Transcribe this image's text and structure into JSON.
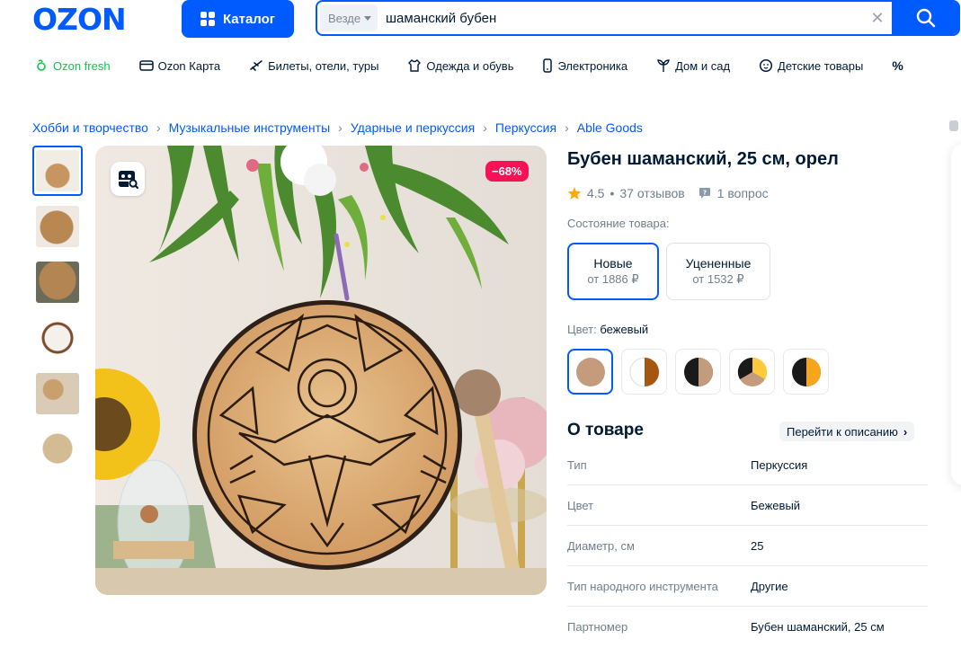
{
  "header": {
    "logo_text": "OZON",
    "catalog_label": "Каталог",
    "search": {
      "scope": "Везде",
      "value": "шаманский бубен"
    }
  },
  "nav": [
    {
      "label": "Ozon fresh",
      "icon": "fresh-icon"
    },
    {
      "label": "Ozon Карта",
      "icon": "card-icon"
    },
    {
      "label": "Билеты, отели, туры",
      "icon": "plane-icon"
    },
    {
      "label": "Одежда и обувь",
      "icon": "clothes-icon"
    },
    {
      "label": "Электроника",
      "icon": "phone-icon"
    },
    {
      "label": "Дом и сад",
      "icon": "plant-icon"
    },
    {
      "label": "Детские товары",
      "icon": "baby-icon"
    }
  ],
  "breadcrumbs": [
    "Хобби и творчество",
    "Музыкальные инструменты",
    "Ударные и перкуссия",
    "Перкуссия",
    "Able Goods"
  ],
  "product": {
    "discount": "−68%",
    "title": "Бубен шаманский, 25 см, орел",
    "rating": "4.5",
    "reviews": "37 отзывов",
    "questions": "1 вопрос",
    "condition_label": "Состояние товара:",
    "conditions": [
      {
        "name": "Новые",
        "price": "от 1886 ₽"
      },
      {
        "name": "Уцененные",
        "price": "от 1532 ₽"
      }
    ],
    "color_label": "Цвет:",
    "color_value": "бежевый",
    "about_title": "О товаре",
    "to_description": "Перейти к описанию",
    "specs": [
      {
        "k": "Тип",
        "v": "Перкуссия"
      },
      {
        "k": "Цвет",
        "v": "Бежевый"
      },
      {
        "k": "Диаметр, см",
        "v": "25"
      },
      {
        "k": "Тип народного инструмента",
        "v": "Другие"
      },
      {
        "k": "Партномер",
        "v": "Бубен шаманский, 25 см"
      }
    ]
  },
  "colors": {
    "brand_blue": "#005bff",
    "fresh_green": "#10c44c",
    "discount_pink": "#f91155"
  }
}
